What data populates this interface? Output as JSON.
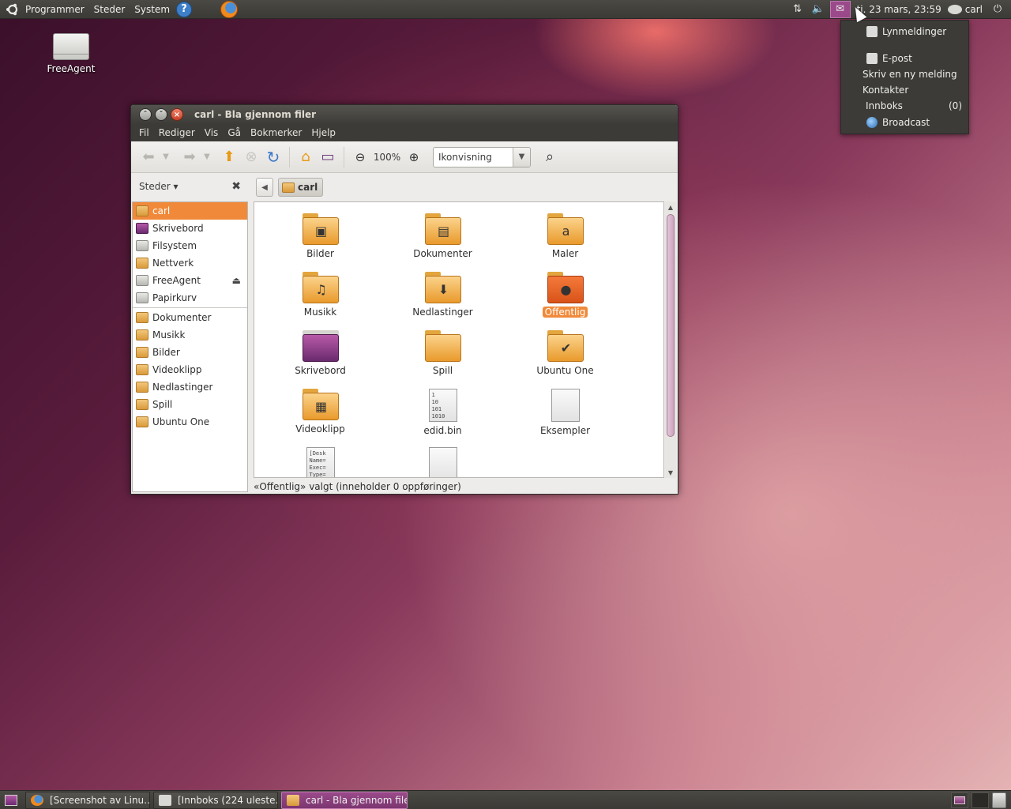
{
  "top_panel": {
    "menus": [
      "Programmer",
      "Steder",
      "System"
    ],
    "clock": "ti. 23 mars, 23:59",
    "user": "carl"
  },
  "desktop": {
    "icons": [
      {
        "label": "FreeAgent",
        "icon": "usb-drive-icon"
      }
    ]
  },
  "window": {
    "title": "carl - Bla gjennom filer",
    "menubar": [
      "Fil",
      "Rediger",
      "Vis",
      "Gå",
      "Bokmerker",
      "Hjelp"
    ],
    "toolbar": {
      "zoom": "100%",
      "view_mode": "Ikonvisning"
    },
    "sidebar": {
      "header": "Steder ▾",
      "places": [
        {
          "label": "carl",
          "icon": "home-folder-icon",
          "selected": true
        },
        {
          "label": "Skrivebord",
          "icon": "desktop-icon"
        },
        {
          "label": "Filsystem",
          "icon": "filesystem-icon"
        },
        {
          "label": "Nettverk",
          "icon": "network-icon"
        },
        {
          "label": "FreeAgent",
          "icon": "usb-drive-icon"
        },
        {
          "label": "Papirkurv",
          "icon": "trash-icon"
        }
      ],
      "bookmarks": [
        {
          "label": "Dokumenter",
          "icon": "documents-folder-icon"
        },
        {
          "label": "Musikk",
          "icon": "music-folder-icon"
        },
        {
          "label": "Bilder",
          "icon": "pictures-folder-icon"
        },
        {
          "label": "Videoklipp",
          "icon": "videos-folder-icon"
        },
        {
          "label": "Nedlastinger",
          "icon": "downloads-folder-icon"
        },
        {
          "label": "Spill",
          "icon": "folder-icon"
        },
        {
          "label": "Ubuntu One",
          "icon": "folder-icon"
        }
      ]
    },
    "path": {
      "current": "carl"
    },
    "files": [
      {
        "label": "Bilder",
        "kind": "folder",
        "emblem": "▣"
      },
      {
        "label": "Dokumenter",
        "kind": "folder",
        "emblem": "▤"
      },
      {
        "label": "Maler",
        "kind": "folder",
        "emblem": "a"
      },
      {
        "label": "Musikk",
        "kind": "folder",
        "emblem": "♫"
      },
      {
        "label": "Nedlastinger",
        "kind": "folder",
        "emblem": "⬇"
      },
      {
        "label": "Offentlig",
        "kind": "folder-orange",
        "emblem": "●",
        "selected": true
      },
      {
        "label": "Skrivebord",
        "kind": "folder-purple",
        "emblem": ""
      },
      {
        "label": "Spill",
        "kind": "folder",
        "emblem": ""
      },
      {
        "label": "Ubuntu One",
        "kind": "folder",
        "emblem": "✔"
      },
      {
        "label": "Videoklipp",
        "kind": "folder",
        "emblem": "▦"
      },
      {
        "label": "edid.bin",
        "kind": "file",
        "preview": "1\n10\n101\n1010"
      },
      {
        "label": "Eksempler",
        "kind": "file",
        "preview": ""
      },
      {
        "label": "",
        "kind": "file",
        "preview": "[Desk\nName=\nExec=\nType="
      },
      {
        "label": "",
        "kind": "file",
        "preview": ""
      }
    ],
    "status": "«Offentlig» valgt (inneholder 0 oppføringer)"
  },
  "messaging_menu": {
    "items": [
      {
        "label": "Lynmeldinger",
        "icon": "chat-icon"
      },
      {
        "label": "E-post",
        "icon": "mail-icon"
      },
      {
        "label": "Skriv en ny melding"
      },
      {
        "label": "Kontakter"
      },
      {
        "label": "Innboks",
        "count": "(0)"
      },
      {
        "label": "Broadcast",
        "icon": "globe-icon"
      }
    ]
  },
  "taskbar": {
    "tasks": [
      {
        "label": "[Screenshot av Linu…",
        "icon": "firefox-icon"
      },
      {
        "label": "[Innboks (224 uleste…",
        "icon": "mail-icon"
      },
      {
        "label": "carl - Bla gjennom filer",
        "icon": "folder-icon",
        "active": true
      }
    ]
  }
}
